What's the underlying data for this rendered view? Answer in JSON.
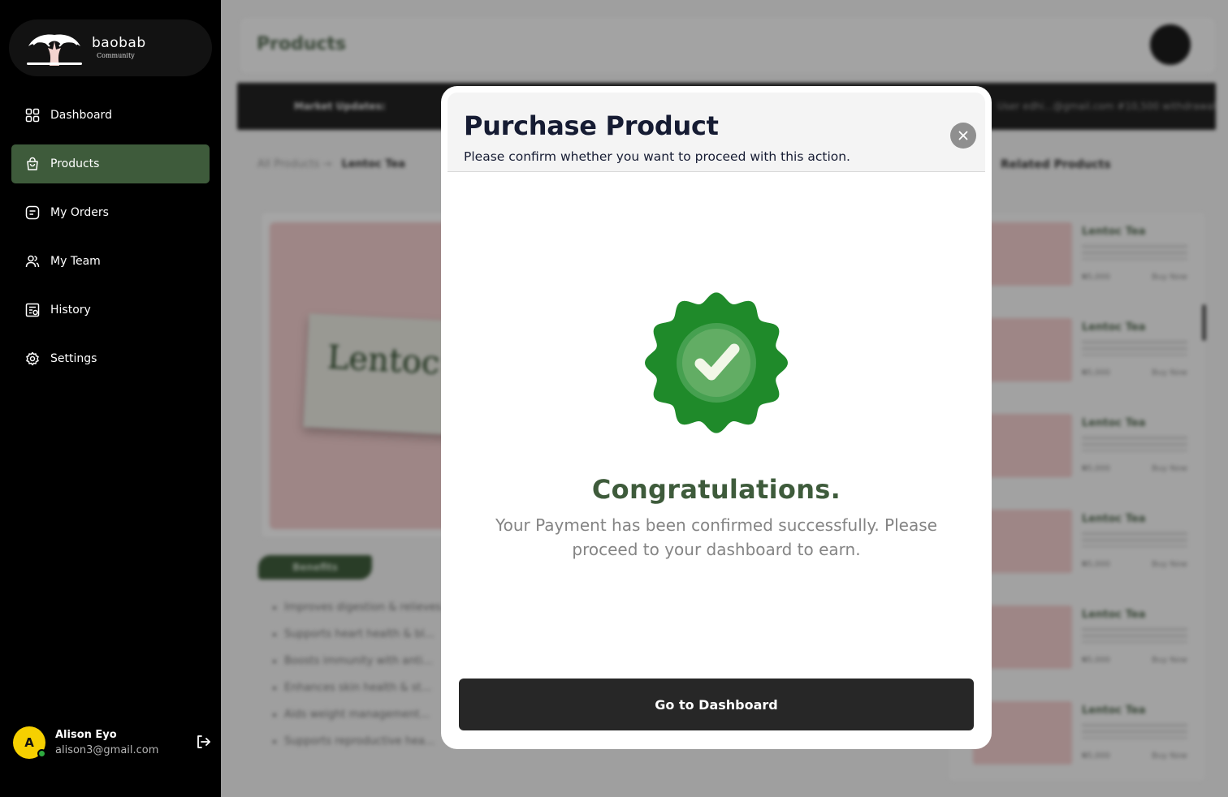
{
  "brand": {
    "name": "baobab",
    "tagline": "Community"
  },
  "sidebar": {
    "items": [
      {
        "label": "Dashboard",
        "icon": "grid-icon",
        "active": false
      },
      {
        "label": "Products",
        "icon": "shopping-bag-icon",
        "active": true
      },
      {
        "label": "My Orders",
        "icon": "orders-icon",
        "active": false
      },
      {
        "label": "My Team",
        "icon": "team-icon",
        "active": false
      },
      {
        "label": "History",
        "icon": "history-icon",
        "active": false
      },
      {
        "label": "Settings",
        "icon": "gear-icon",
        "active": false
      }
    ]
  },
  "user": {
    "initial": "A",
    "name": "Alison Eyo",
    "email": "alison3@gmail.com",
    "status_color": "#2eaa3f"
  },
  "background": {
    "page_title": "Products",
    "marquee_label": "Market Updates:",
    "marquee_text": "User edhi...@gmail.com #10,500 withdrawal",
    "breadcrumb_root": "All Products",
    "breadcrumb_current": "Lentoc Tea",
    "related_title": "Related Products",
    "product_box_text": "Lentoc",
    "benefits_label": "Benefits",
    "benefits": [
      "Improves digestion & relieves...",
      "Supports heart health & bl...",
      "Boosts immunity with anti...",
      "Enhances skin health & st...",
      "Aids weight management...",
      "Supports reproductive hea..."
    ],
    "related_products": [
      {
        "name": "Lentoc Tea",
        "price": "₦5,000",
        "cta": "Buy Now"
      },
      {
        "name": "Lentoc Tea",
        "price": "₦5,000",
        "cta": "Buy Now"
      },
      {
        "name": "Lentoc Tea",
        "price": "₦5,000",
        "cta": "Buy Now"
      },
      {
        "name": "Lentoc Tea",
        "price": "₦5,000",
        "cta": "Buy Now"
      },
      {
        "name": "Lentoc Tea",
        "price": "₦5,000",
        "cta": "Buy Now"
      },
      {
        "name": "Lentoc Tea",
        "price": "₦5,000",
        "cta": "Buy Now"
      }
    ]
  },
  "modal": {
    "title": "Purchase Product",
    "subtitle": "Please confirm whether you want to proceed with this action.",
    "close_icon": "close-icon",
    "success_icon": "check-badge-icon",
    "heading": "Congratulations.",
    "message": "Your Payment has been confirmed successfully. Please proceed to your dashboard to earn.",
    "button_label": "Go to Dashboard"
  },
  "colors": {
    "accent": "#3e5b3b",
    "badge_green": "#1f8a2a",
    "sidebar_bg": "#000000",
    "button_bg": "#272727"
  }
}
